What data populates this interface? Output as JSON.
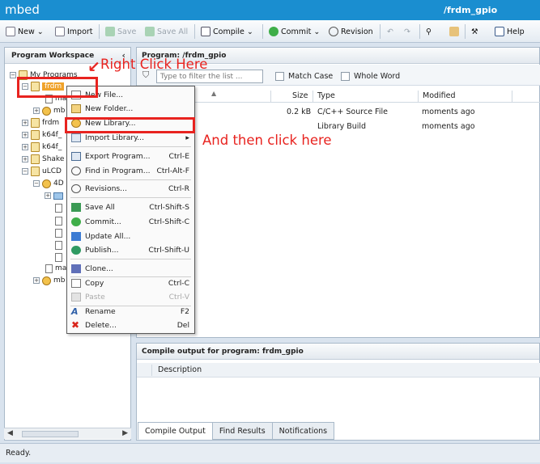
{
  "app": {
    "title": "mbed",
    "path": "/frdm_gpio"
  },
  "toolbar": {
    "new": "New",
    "import": "Import",
    "save": "Save",
    "save_all": "Save All",
    "compile": "Compile",
    "commit": "Commit",
    "revision": "Revision",
    "help": "Help"
  },
  "workspace": {
    "title": "Program Workspace",
    "collapse": "‹",
    "items": [
      {
        "label": "My Programs",
        "type": "root"
      },
      {
        "label": "frdm",
        "type": "program"
      },
      {
        "label": "ma",
        "type": "file"
      },
      {
        "label": "mb",
        "type": "library"
      },
      {
        "label": "frdm",
        "type": "program"
      },
      {
        "label": "k64f_",
        "type": "program"
      },
      {
        "label": "k64f_",
        "type": "program"
      },
      {
        "label": "Shake",
        "type": "program"
      },
      {
        "label": "uLCD",
        "type": "program"
      },
      {
        "label": "4D",
        "type": "library"
      },
      {
        "label": "",
        "type": "folder"
      },
      {
        "label": "",
        "type": "file"
      },
      {
        "label": "",
        "type": "file"
      },
      {
        "label": "",
        "type": "file"
      },
      {
        "label": "",
        "type": "file"
      },
      {
        "label": "",
        "type": "file"
      },
      {
        "label": "ma",
        "type": "file"
      },
      {
        "label": "mb",
        "type": "library"
      }
    ]
  },
  "program": {
    "header": "Program: /frdm_gpio",
    "filter_placeholder": "Type to filter the list ...",
    "match_case": "Match Case",
    "whole_word": "Whole Word",
    "columns": [
      "Size",
      "Type",
      "Modified"
    ],
    "rows": [
      {
        "size": "0.2 kB",
        "type": "C/C++ Source File",
        "modified": "moments ago"
      },
      {
        "size": "",
        "type": "Library Build",
        "modified": "moments ago"
      }
    ]
  },
  "output": {
    "header": "Compile output for program: frdm_gpio",
    "column": "Description",
    "tabs": [
      "Compile Output",
      "Find Results",
      "Notifications"
    ]
  },
  "status": "Ready.",
  "context_menu": [
    {
      "label": "New File...",
      "shortcut": "",
      "icon": "new-file-icon",
      "enabled": true
    },
    {
      "label": "New Folder...",
      "shortcut": "",
      "icon": "new-folder-icon",
      "enabled": true
    },
    {
      "label": "New Library...",
      "shortcut": "",
      "icon": "new-library-icon",
      "enabled": true
    },
    {
      "label": "Import Library...",
      "shortcut": "",
      "icon": "import-library-icon",
      "enabled": true
    },
    {
      "label": "Export Program...",
      "shortcut": "Ctrl-E",
      "icon": "export-icon",
      "enabled": true
    },
    {
      "label": "Find in Program...",
      "shortcut": "Ctrl-Alt-F",
      "icon": "find-icon",
      "enabled": true
    },
    {
      "label": "Revisions...",
      "shortcut": "Ctrl-R",
      "icon": "revisions-icon",
      "enabled": true
    },
    {
      "label": "Save All",
      "shortcut": "Ctrl-Shift-S",
      "icon": "save-icon",
      "enabled": true
    },
    {
      "label": "Commit...",
      "shortcut": "Ctrl-Shift-C",
      "icon": "commit-icon",
      "enabled": true
    },
    {
      "label": "Update All...",
      "shortcut": "",
      "icon": "update-icon",
      "enabled": true
    },
    {
      "label": "Publish...",
      "shortcut": "Ctrl-Shift-U",
      "icon": "publish-icon",
      "enabled": true
    },
    {
      "label": "Clone...",
      "shortcut": "",
      "icon": "clone-icon",
      "enabled": true
    },
    {
      "label": "Copy",
      "shortcut": "Ctrl-C",
      "icon": "copy-icon",
      "enabled": true
    },
    {
      "label": "Paste",
      "shortcut": "Ctrl-V",
      "icon": "paste-icon",
      "enabled": false
    },
    {
      "label": "Rename",
      "shortcut": "F2",
      "icon": "rename-icon",
      "enabled": true
    },
    {
      "label": "Delete...",
      "shortcut": "Del",
      "icon": "delete-icon",
      "enabled": true
    }
  ],
  "annotations": {
    "right_click": "Right Click Here",
    "then_click": "And then click here",
    "color": "#e8231f"
  },
  "colors": {
    "titlebar": "#1a8ed0",
    "selection": "#f0a32c"
  }
}
